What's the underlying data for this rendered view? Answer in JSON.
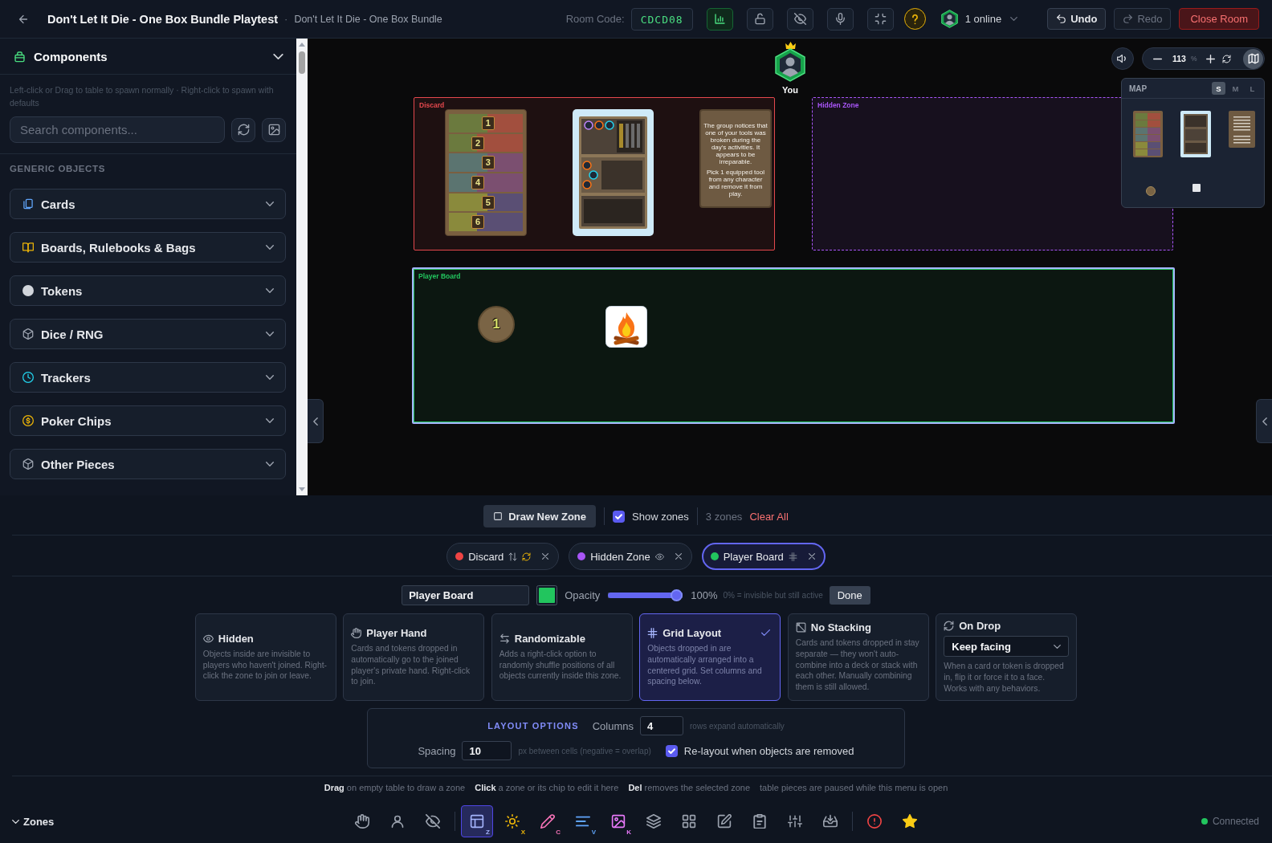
{
  "topbar": {
    "title": "Don't Let It Die - One Box Bundle Playtest",
    "separator": "·",
    "subtitle": "Don't Let It Die - One Box Bundle",
    "room_code_label": "Room Code:",
    "room_code": "CDCD08",
    "tools": [
      {
        "kind": "stats",
        "active": true
      },
      {
        "kind": "lock",
        "active": false
      },
      {
        "kind": "hide",
        "active": false
      },
      {
        "kind": "mic",
        "active": false
      },
      {
        "kind": "fullscreen",
        "active": false
      },
      {
        "kind": "help",
        "active": false
      }
    ],
    "presence": "1 online",
    "actions": [
      {
        "kind": "undo",
        "label": "Undo",
        "disabled": false
      },
      {
        "kind": "redo",
        "label": "Redo",
        "disabled": true
      },
      {
        "kind": "close",
        "label": "Close Room",
        "disabled": false
      }
    ]
  },
  "sidebar": {
    "title": "Components",
    "hint": "Left-click or Drag to table to spawn normally · Right-click to spawn with defaults",
    "search": {
      "placeholder": "Search components..."
    },
    "section": "GENERIC OBJECTS",
    "items": [
      {
        "kind": "cards",
        "label": "Cards"
      },
      {
        "kind": "boards",
        "label": "Boards, Rulebooks & Bags"
      },
      {
        "kind": "tokens",
        "label": "Tokens"
      },
      {
        "kind": "dice",
        "label": "Dice / RNG"
      },
      {
        "kind": "trackers",
        "label": "Trackers"
      },
      {
        "kind": "chips",
        "label": "Poker Chips"
      },
      {
        "kind": "other",
        "label": "Other Pieces"
      }
    ]
  },
  "table": {
    "player": {
      "label": "You",
      "host": true
    },
    "zones": [
      {
        "name": "Discard",
        "color": "#e5484d",
        "hidden": false,
        "selected": false,
        "pieces": [
          {
            "kind": "track",
            "numbers": [
              "1",
              "2",
              "3",
              "4",
              "5",
              "6"
            ]
          },
          {
            "kind": "reference"
          },
          {
            "kind": "event",
            "paragraphs": [
              "The group notices that one of your tools was broken during the day's activities. It appears to be irreparable.",
              "Pick 1 equipped tool from any character and remove it from play."
            ]
          }
        ]
      },
      {
        "name": "Hidden Zone",
        "color": "#a855f7",
        "hidden": true,
        "selected": false
      },
      {
        "name": "Player Board",
        "color": "#22c55e",
        "hidden": false,
        "selected": true,
        "pieces": [
          {
            "kind": "token",
            "label": "1"
          },
          {
            "kind": "campfire"
          }
        ]
      }
    ],
    "zoom": {
      "value": "113",
      "unit": "%"
    },
    "minimap": {
      "open": true,
      "title": "MAP",
      "sizes": [
        {
          "label": "S",
          "selected": true
        },
        {
          "label": "M",
          "selected": false
        },
        {
          "label": "L",
          "selected": false
        }
      ]
    }
  },
  "editor": {
    "draw_button": "Draw New Zone",
    "show_zones": {
      "label": "Show zones",
      "checked": true
    },
    "zone_count": "3 zones",
    "clear_all": "Clear All",
    "chips": [
      {
        "name": "Discard",
        "color": "#ef4444",
        "selected": false,
        "flags": [
          {
            "kind": "sort"
          },
          {
            "kind": "flip"
          }
        ]
      },
      {
        "name": "Hidden Zone",
        "color": "#a855f7",
        "selected": false,
        "flags": [
          {
            "kind": "hidden"
          }
        ]
      },
      {
        "name": "Player Board",
        "color": "#22c55e",
        "selected": true,
        "flags": [
          {
            "kind": "grid"
          }
        ]
      }
    ],
    "name_value": "Player Board",
    "color": "#22c55e",
    "opacity": {
      "label": "Opacity",
      "level": 1,
      "reading": "100%",
      "note": "0% = invisible but still active"
    },
    "done": "Done",
    "behaviors": [
      {
        "kind": "hidden",
        "title": "Hidden",
        "text": "Objects inside are invisible to players who haven't joined. Right-click the zone to join or leave.",
        "selected": false
      },
      {
        "kind": "hand",
        "title": "Player Hand",
        "text": "Cards and tokens dropped in automatically go to the joined player's private hand. Right-click to join.",
        "selected": false
      },
      {
        "kind": "random",
        "title": "Randomizable",
        "text": "Adds a right-click option to randomly shuffle positions of all objects currently inside this zone.",
        "selected": false
      },
      {
        "kind": "grid",
        "title": "Grid Layout",
        "text": "Objects dropped in are automatically arranged into a centered grid. Set columns and spacing below.",
        "selected": true
      },
      {
        "kind": "nostack",
        "title": "No Stacking",
        "text": "Cards and tokens dropped in stay separate — they won't auto-combine into a deck or stack with each other. Manually combining them is still allowed.",
        "selected": false
      },
      {
        "kind": "ondrop",
        "title": "On Drop",
        "select": "Keep facing",
        "text": "When a card or token is dropped in, flip it or force it to a face. Works with any behaviors.",
        "selected": false
      }
    ],
    "layout_options": {
      "title": "LAYOUT OPTIONS",
      "columns": {
        "label": "Columns",
        "value": "4",
        "note": "rows expand automatically"
      },
      "spacing": {
        "label": "Spacing",
        "value": "10",
        "note": "px between cells (negative = overlap)"
      },
      "relayout": {
        "label": "Re-layout when objects are removed",
        "checked": true
      }
    },
    "hints": [
      "**Drag** on empty table to draw a zone",
      "**Click** a zone or its chip to edit it here",
      "**Del** removes the selected zone",
      "table pieces are paused while this menu is open"
    ]
  },
  "bottom_bar": {
    "panel_label": "Zones",
    "tool_groups": [
      {
        "tools": [
          {
            "kind": "hand",
            "selected": false
          },
          {
            "kind": "person",
            "selected": false
          },
          {
            "kind": "hide",
            "selected": false
          }
        ]
      },
      {
        "tools": [
          {
            "kind": "zones",
            "selected": true,
            "shortcut": "Z"
          },
          {
            "kind": "effects",
            "selected": false,
            "shortcut": "X"
          },
          {
            "kind": "draw",
            "selected": false,
            "shortcut": "C"
          },
          {
            "kind": "text",
            "selected": false,
            "shortcut": "V"
          },
          {
            "kind": "image",
            "selected": false,
            "shortcut": "K"
          },
          {
            "kind": "layers",
            "selected": false
          },
          {
            "kind": "grid",
            "selected": false
          },
          {
            "kind": "edit",
            "selected": false
          },
          {
            "kind": "clipboard",
            "selected": false
          },
          {
            "kind": "sliders",
            "selected": false
          },
          {
            "kind": "import",
            "selected": false
          }
        ]
      },
      {
        "tools": [
          {
            "kind": "alert",
            "selected": false
          },
          {
            "kind": "star",
            "selected": false
          }
        ]
      }
    ],
    "status": {
      "label": "Connected",
      "connected": true
    }
  }
}
